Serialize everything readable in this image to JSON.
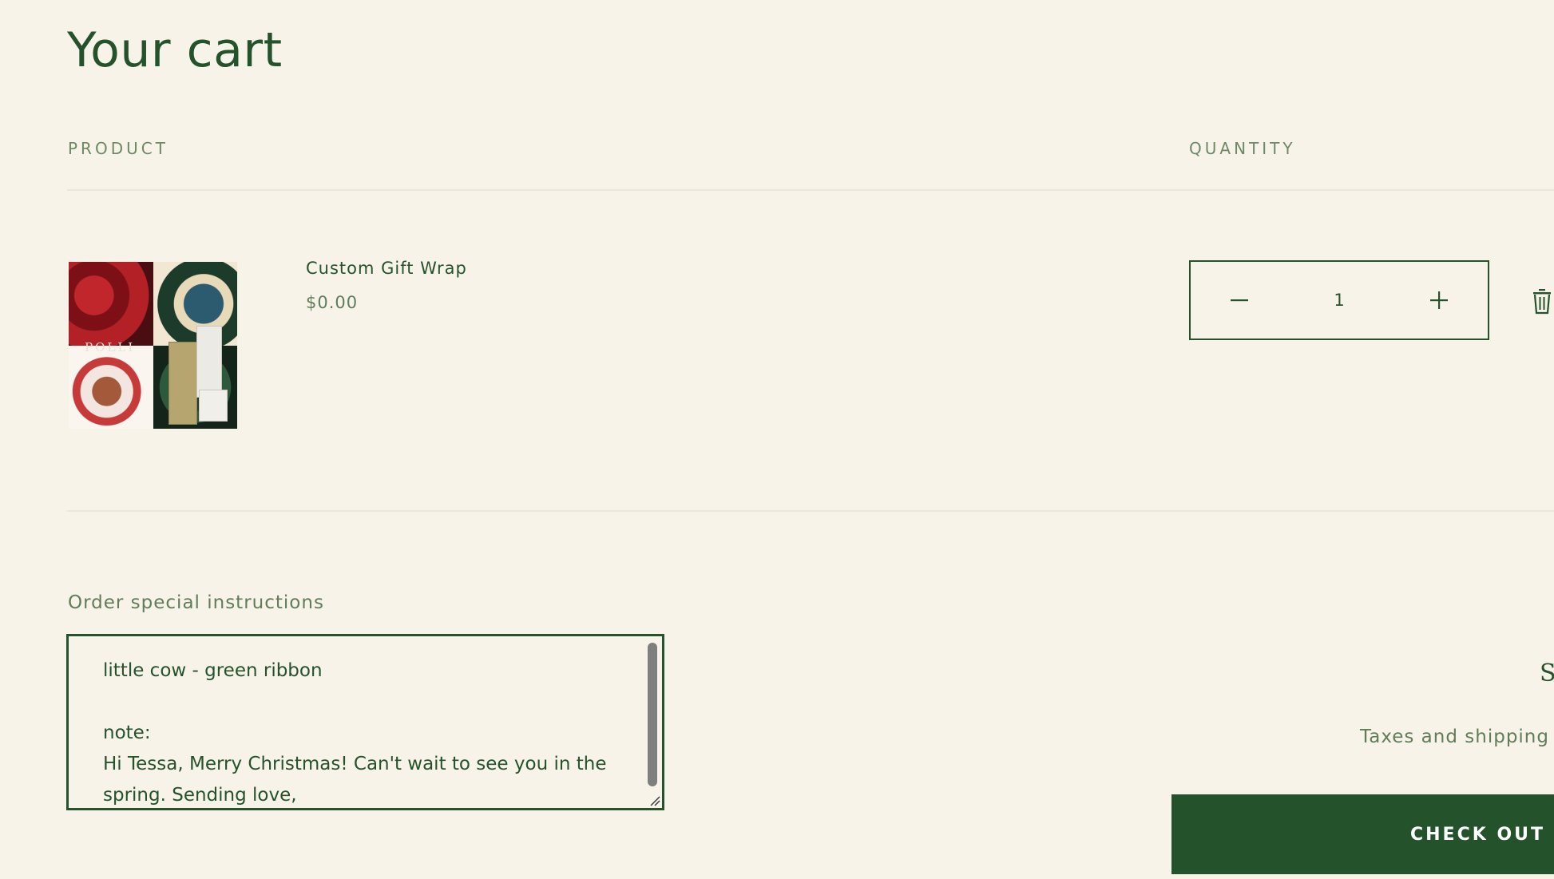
{
  "page": {
    "title": "Your cart"
  },
  "table": {
    "headers": {
      "product": "PRODUCT",
      "quantity": "QUANTITY"
    }
  },
  "cart_item": {
    "name": "Custom Gift Wrap",
    "price": "$0.00",
    "quantity": "1",
    "image_brand_text": "POLLI",
    "icons": {
      "decrease": "minus-icon",
      "increase": "plus-icon",
      "remove": "trash-icon"
    }
  },
  "instructions": {
    "label": "Order special instructions",
    "value": "little cow - green ribbon\n\nnote:\nHi Tessa, Merry Christmas! Can't wait to see you in the spring. Sending love,"
  },
  "summary": {
    "subtotal_fragment": "Su",
    "taxes_note": "Taxes and shipping c",
    "checkout_label": "CHECK OUT"
  },
  "colors": {
    "background": "#f8f3e9",
    "primary": "#24532b",
    "muted_text": "#5f7d58",
    "divider": "#ebe6da"
  }
}
